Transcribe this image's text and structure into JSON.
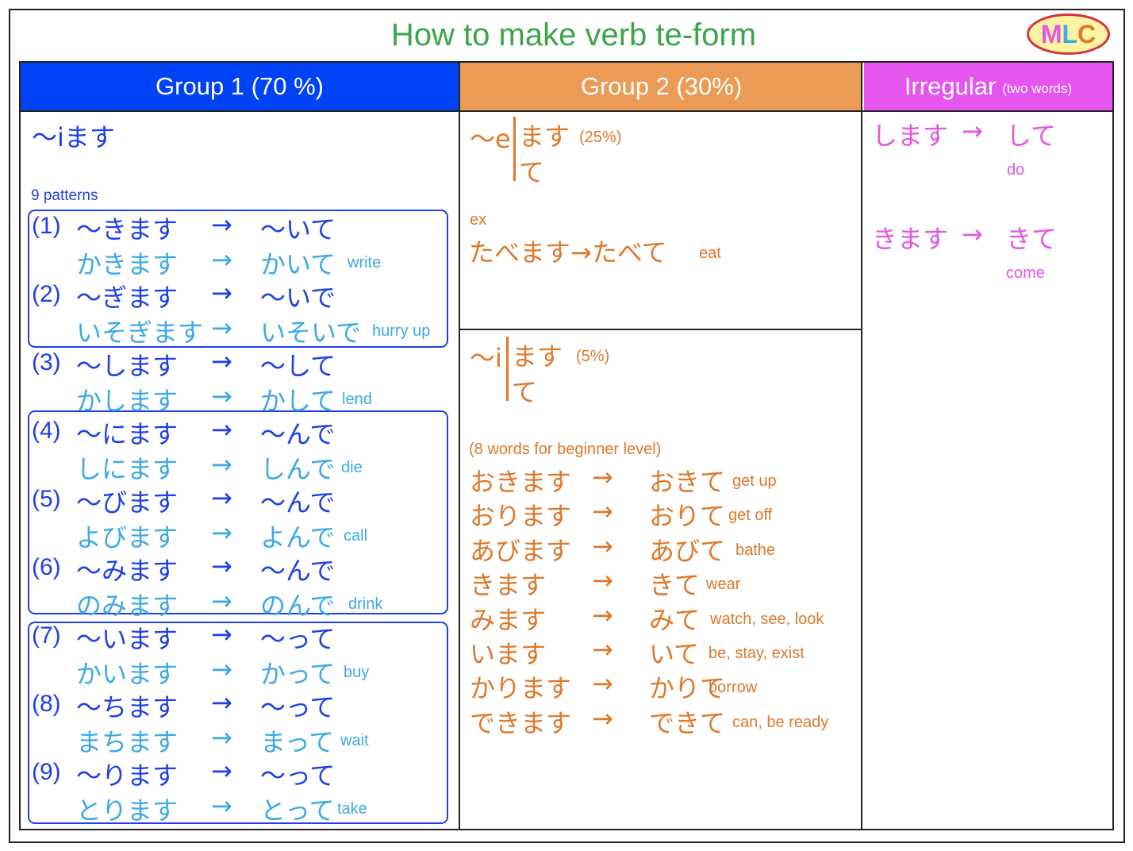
{
  "title": "How to make verb te-form",
  "logo": "MLC",
  "colors": {
    "title": "#3aa648",
    "group1": "#0042f5",
    "group2": "#eb9b55",
    "irregular": "#e655f0"
  },
  "headers": {
    "g1": "Group 1 (70 %)",
    "g2": "Group 2 (30%)",
    "irr": "Irregular",
    "irr_note": "(two words)"
  },
  "g1": {
    "rule": "〜iます",
    "patterns_label": "9 patterns",
    "rows": [
      {
        "n": "(1)",
        "f": "〜きます",
        "t": "〜いて",
        "ef": "かきます",
        "et": "かいて",
        "en": "write"
      },
      {
        "n": "(2)",
        "f": "〜ぎます",
        "t": "〜いで",
        "ef": "いそぎます",
        "et": "いそいで",
        "en": "hurry up"
      },
      {
        "n": "(3)",
        "f": "〜します",
        "t": "〜して",
        "ef": "かします",
        "et": "かして",
        "en": "lend"
      },
      {
        "n": "(4)",
        "f": "〜にます",
        "t": "〜んで",
        "ef": "しにます",
        "et": "しんで",
        "en": "die"
      },
      {
        "n": "(5)",
        "f": "〜びます",
        "t": "〜んで",
        "ef": "よびます",
        "et": "よんで",
        "en": "call"
      },
      {
        "n": "(6)",
        "f": "〜みます",
        "t": "〜んで",
        "ef": "のみます",
        "et": "のんで",
        "en": "drink"
      },
      {
        "n": "(7)",
        "f": "〜います",
        "t": "〜って",
        "ef": "かいます",
        "et": "かって",
        "en": "buy"
      },
      {
        "n": "(8)",
        "f": "〜ちます",
        "t": "〜って",
        "ef": "まちます",
        "et": "まって",
        "en": "wait"
      },
      {
        "n": "(9)",
        "f": "〜ります",
        "t": "〜って",
        "ef": "とります",
        "et": "とって",
        "en": "take"
      }
    ],
    "arrow": "→"
  },
  "g2": {
    "e_rule_pre": "〜e",
    "e_rule_masu": "ます",
    "e_pct": "(25%)",
    "e_te": "て",
    "ex_label": "ex",
    "ex": "たべます→たべて",
    "ex_en": "eat",
    "i_rule_pre": "〜i",
    "i_rule_masu": "ます",
    "i_pct": "(5%)",
    "i_te": "て",
    "words_label": "(8 words for beginner level)",
    "words": [
      {
        "f": "おきます",
        "t": "おきて",
        "en": "get up"
      },
      {
        "f": "おります",
        "t": "おりて",
        "en": "get off"
      },
      {
        "f": "あびます",
        "t": "あびて",
        "en": "bathe"
      },
      {
        "f": "きます",
        "t": "きて",
        "en": "wear"
      },
      {
        "f": "みます",
        "t": "みて",
        "en": "watch, see, look"
      },
      {
        "f": "います",
        "t": "いて",
        "en": "be, stay, exist"
      },
      {
        "f": "かります",
        "t": "かりて",
        "en": "borrow"
      },
      {
        "f": "できます",
        "t": "できて",
        "en": "can, be ready"
      }
    ],
    "arrow": "→"
  },
  "irr": {
    "items": [
      {
        "f": "します",
        "t": "して",
        "en": "do"
      },
      {
        "f": "きます",
        "t": "きて",
        "en": "come"
      }
    ],
    "arrow": "→"
  }
}
